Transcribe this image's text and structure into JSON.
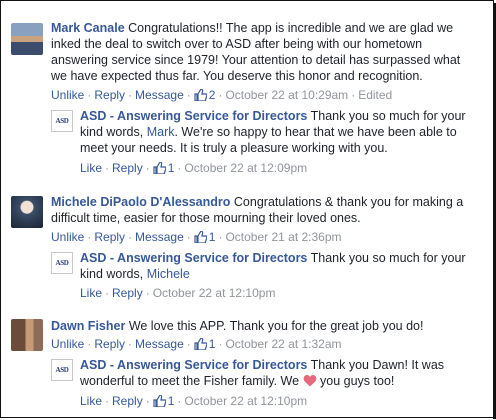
{
  "colors": {
    "link": "#365899",
    "meta": "#90949c",
    "text": "#1d2129",
    "heart": "#e66a7b"
  },
  "icons": {
    "like": "thumbs-up-icon",
    "heart": "heart-icon"
  },
  "comments": [
    {
      "author": "Mark Canale",
      "text_lines": [
        "Congratulations!! The app is incredible and we are glad we",
        "inked the deal to switch over to ASD after being with our hometown",
        "answering service since 1979! Your attention to detail has surpassed what",
        "we have expected thus far. You deserve this honor and recognition."
      ],
      "actions": {
        "unlike": "Unlike",
        "reply": "Reply",
        "message": "Message",
        "likes": "2",
        "time": "October 22 at 10:29am",
        "edited": "Edited"
      },
      "reply": {
        "author": "ASD - Answering Service for Directors",
        "logo": "ASD",
        "line1": "Thank you so much for your",
        "line2_pre": "kind words, ",
        "mention": "Mark",
        "line2_post": ". We're so happy to hear that we have been able to",
        "line3": "meet your needs. It is truly a pleasure working with you.",
        "actions": {
          "like": "Like",
          "reply": "Reply",
          "likes": "1",
          "time": "October 22 at 12:09pm"
        }
      }
    },
    {
      "author": "Michele DiPaolo D'Alessandro",
      "text_lines": [
        "Congratulations & thank you for making a",
        "difficult time, easier for those mourning their loved ones."
      ],
      "actions": {
        "unlike": "Unlike",
        "reply": "Reply",
        "message": "Message",
        "likes": "1",
        "time": "October 21 at 2:36pm"
      },
      "reply": {
        "author": "ASD - Answering Service for Directors",
        "logo": "ASD",
        "line1": "Thank you so much for your",
        "line2_pre": "kind words, ",
        "mention": "Michele",
        "actions": {
          "like": "Like",
          "reply": "Reply",
          "time": "October 22 at 12:10pm"
        }
      }
    },
    {
      "author": "Dawn Fisher",
      "text": "We love this APP. Thank you for the great job you do!",
      "actions": {
        "unlike": "Unlike",
        "reply": "Reply",
        "message": "Message",
        "likes": "1",
        "time": "October 22 at 1:32am"
      },
      "reply": {
        "author": "ASD - Answering Service for Directors",
        "logo": "ASD",
        "line1": "Thank you Dawn! It was",
        "line2_pre": "wonderful to meet the Fisher family. We ",
        "line2_post": " you guys too!",
        "actions": {
          "like": "Like",
          "reply": "Reply",
          "likes": "1",
          "time": "October 22 at 12:10pm"
        }
      }
    }
  ]
}
